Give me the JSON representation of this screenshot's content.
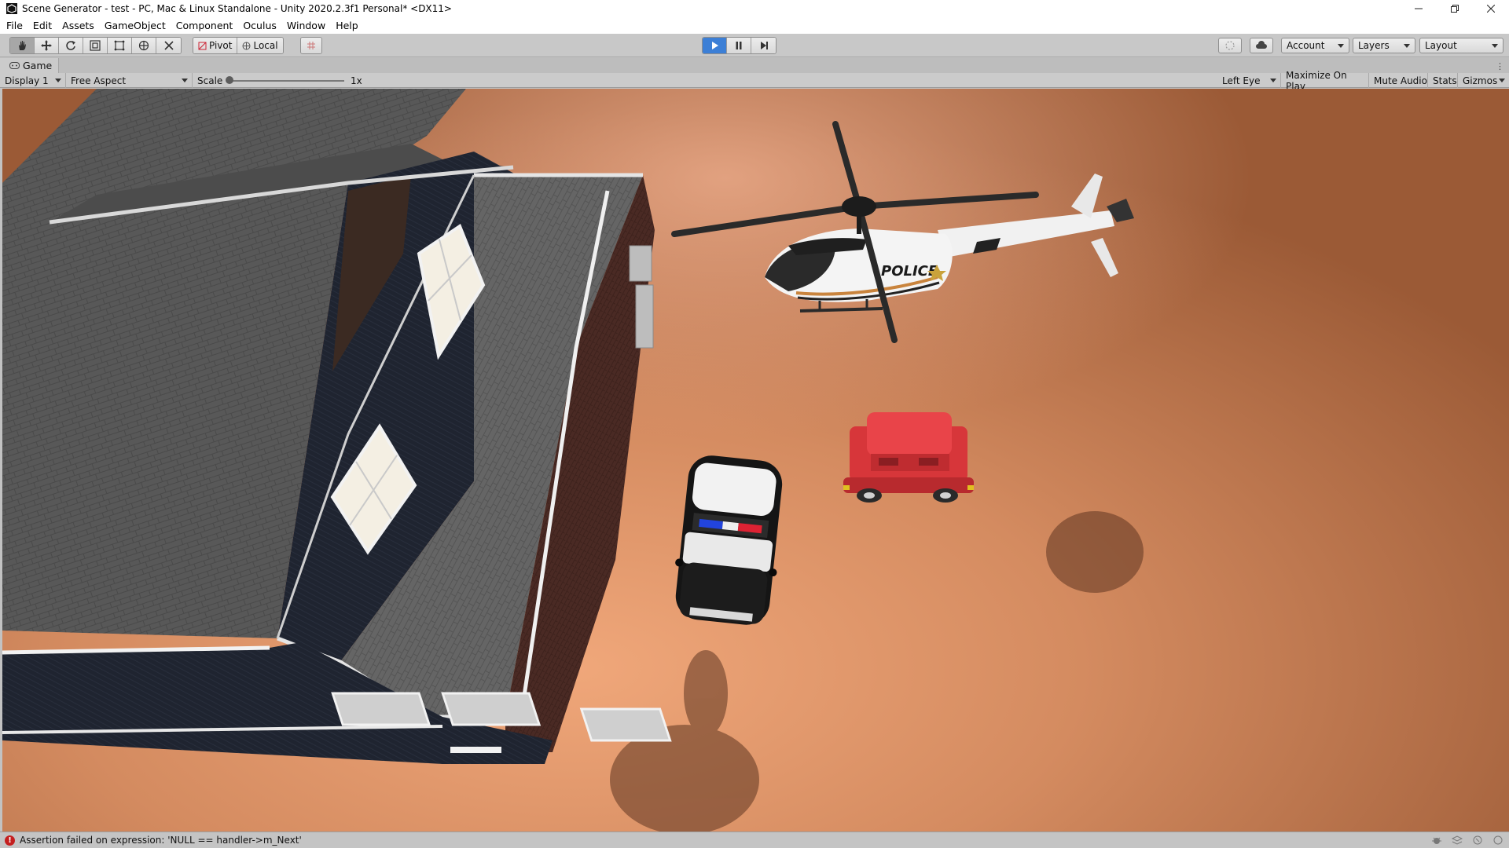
{
  "window": {
    "title": "Scene Generator - test - PC, Mac & Linux Standalone - Unity 2020.2.3f1 Personal* <DX11>",
    "controls": [
      "minimize",
      "restore",
      "close"
    ]
  },
  "menu": {
    "items": [
      "File",
      "Edit",
      "Assets",
      "GameObject",
      "Component",
      "Oculus",
      "Window",
      "Help"
    ]
  },
  "toolbar": {
    "tools": [
      "hand-tool",
      "move-tool",
      "rotate-tool",
      "scale-tool",
      "rect-tool",
      "transform-tool",
      "custom-tool"
    ],
    "pivot_label": "Pivot",
    "local_label": "Local",
    "play_state": "playing",
    "account_label": "Account",
    "layers_label": "Layers",
    "layout_label": "Layout"
  },
  "game_tab": {
    "label": "Game"
  },
  "game_controls": {
    "display": "Display 1",
    "aspect": "Free Aspect",
    "scale_label": "Scale",
    "scale_value": "1x",
    "eye": "Left Eye",
    "maximize_on_play": "Maximize On Play",
    "mute_audio": "Mute Audio",
    "stats": "Stats",
    "gizmos": "Gizmos"
  },
  "scene": {
    "helicopter_text": "POLICE",
    "ground_color": "#c9835a",
    "car_color": "#e0383b"
  },
  "status": {
    "message": "Assertion failed on expression: 'NULL == handler->m_Next'"
  },
  "colors": {
    "play_active": "#3c7fd6",
    "error": "#c41f1f"
  }
}
